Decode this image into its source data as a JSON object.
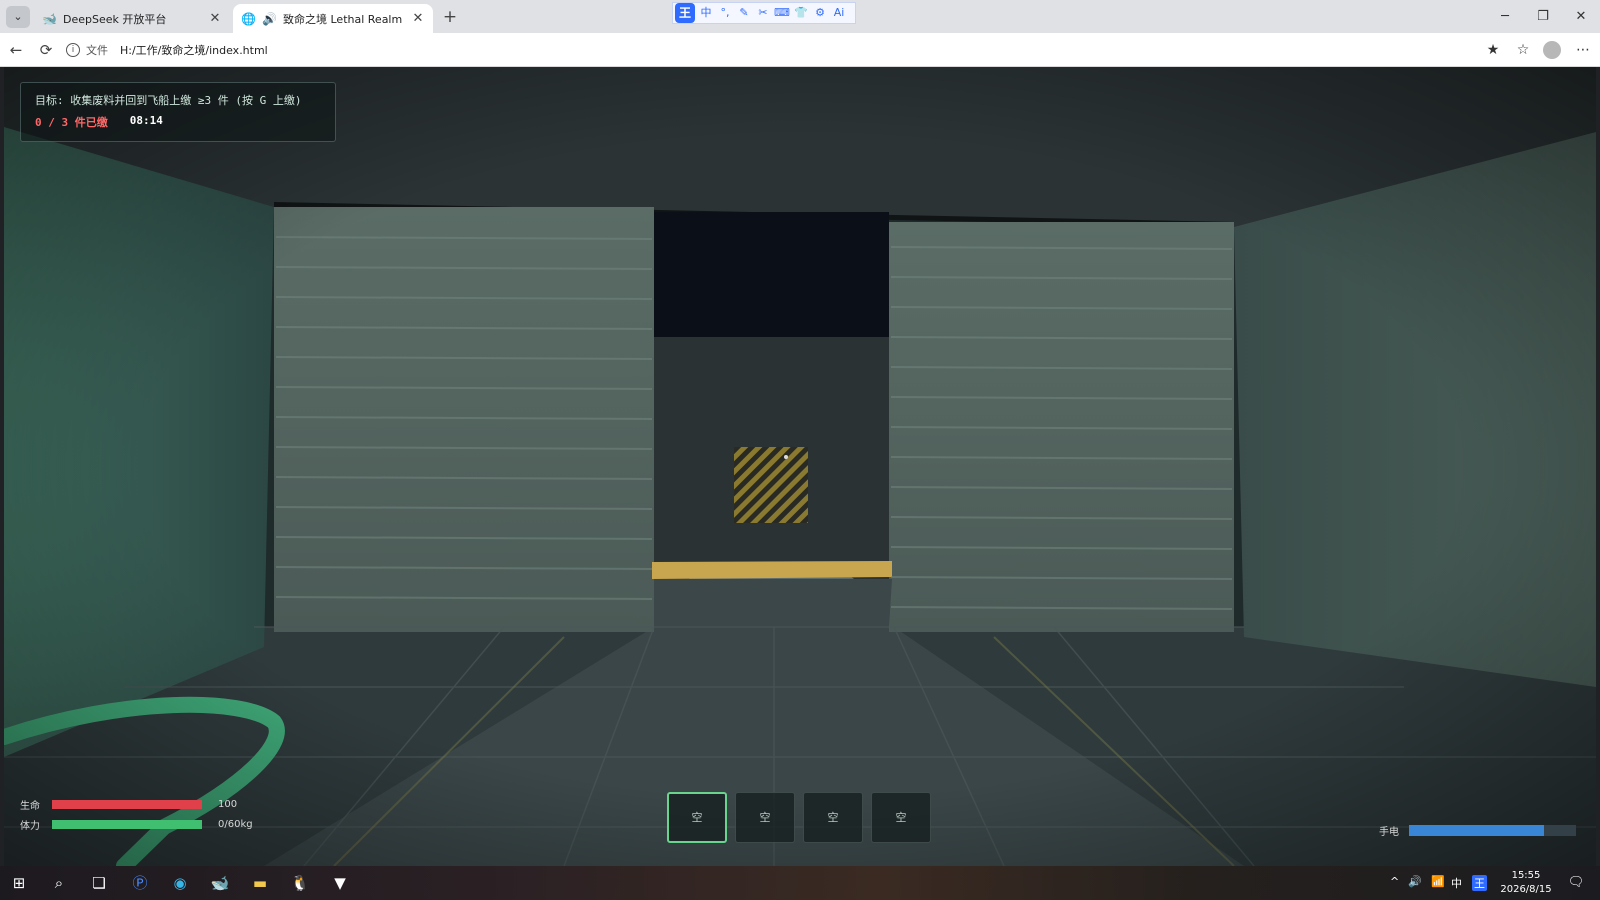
{
  "browser": {
    "tabs": [
      {
        "title": "DeepSeek 开放平台",
        "icon": "deepseek-whale-icon",
        "active": false
      },
      {
        "title": "致命之境 Lethal Realm",
        "icon": "globe-icon",
        "active": true,
        "audio": true
      }
    ],
    "address": {
      "label": "文件",
      "url": "H:/工作/致命之境/index.html"
    },
    "ime_logo": "王",
    "ime_buttons": [
      "中",
      "°,",
      "✎",
      "✂",
      "⌨",
      "👕",
      "⚙",
      "Ai"
    ]
  },
  "hud": {
    "objective": "目标: 收集废料并回到飞船上缴 ≥3 件 (按 G 上缴)",
    "delivered": "0 / 3 件已缴",
    "timer": "08:14",
    "health": {
      "label": "生命",
      "value": "100",
      "fraction": 1.0,
      "color": "#e0404a"
    },
    "stamina": {
      "label": "体力",
      "value": "0/60kg",
      "fraction": 1.0,
      "color": "#3fbf6f"
    },
    "hotbar": [
      "空",
      "空",
      "空",
      "空"
    ],
    "selected_slot": 0,
    "flashlight": {
      "label": "手电",
      "fraction": 0.81
    }
  },
  "taskbar": {
    "clock_time": "15:55",
    "clock_date": "2026/8/15",
    "ime": "中",
    "ime_badge": "王"
  }
}
